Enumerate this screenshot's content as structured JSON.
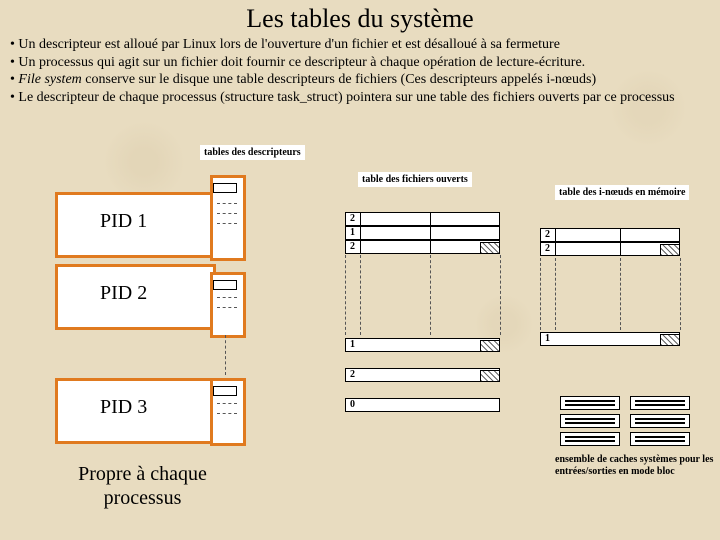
{
  "title": "Les tables du système",
  "bullets": [
    "Un descripteur est alloué par Linux lors de l'ouverture d'un fichier et est désalloué à sa fermeture",
    "Un processus qui agit sur un fichier doit fournir ce descripteur à chaque opération de lecture-écriture.",
    "File system conserve sur le disque une table descripteurs de fichiers (Ces descripteurs appelés i-nœuds)",
    "Le descripteur de chaque processus (structure task_struct) pointera sur une table des fichiers ouverts par ce processus"
  ],
  "labels": {
    "desc_table": "tables des\ndescripteurs",
    "open_files": "table des\nfichiers\nouverts",
    "inodes": "table des\ni-nœuds en\nmémoire",
    "caches": "ensemble de caches systèmes pour les\nentrées/sorties en mode bloc",
    "per_process": "Propre à chaque\nprocessus"
  },
  "pids": [
    "PID 1",
    "PID 2",
    "PID 3"
  ],
  "open_table_counts_top": [
    "2",
    "1",
    "2"
  ],
  "open_table_counts_mid": [
    "1",
    "2",
    "0"
  ],
  "inode_counts": [
    "2",
    "2"
  ],
  "inode_count_mid": "1",
  "chart_data": {
    "type": "table",
    "title": "Relations entre structures noyau Linux pour fichiers ouverts",
    "processes": [
      {
        "pid": "PID 1",
        "descriptor_slots": 3
      },
      {
        "pid": "PID 2",
        "descriptor_slots": 3
      },
      {
        "pid": "PID 3",
        "descriptor_slots": 3
      }
    ],
    "open_files_entries": [
      {
        "refcount": 2
      },
      {
        "refcount": 1
      },
      {
        "refcount": 2
      },
      {
        "refcount": 1
      },
      {
        "refcount": 2
      },
      {
        "refcount": 0
      }
    ],
    "inode_entries": [
      {
        "refcount": 2
      },
      {
        "refcount": 2
      },
      {
        "refcount": 1
      }
    ]
  }
}
